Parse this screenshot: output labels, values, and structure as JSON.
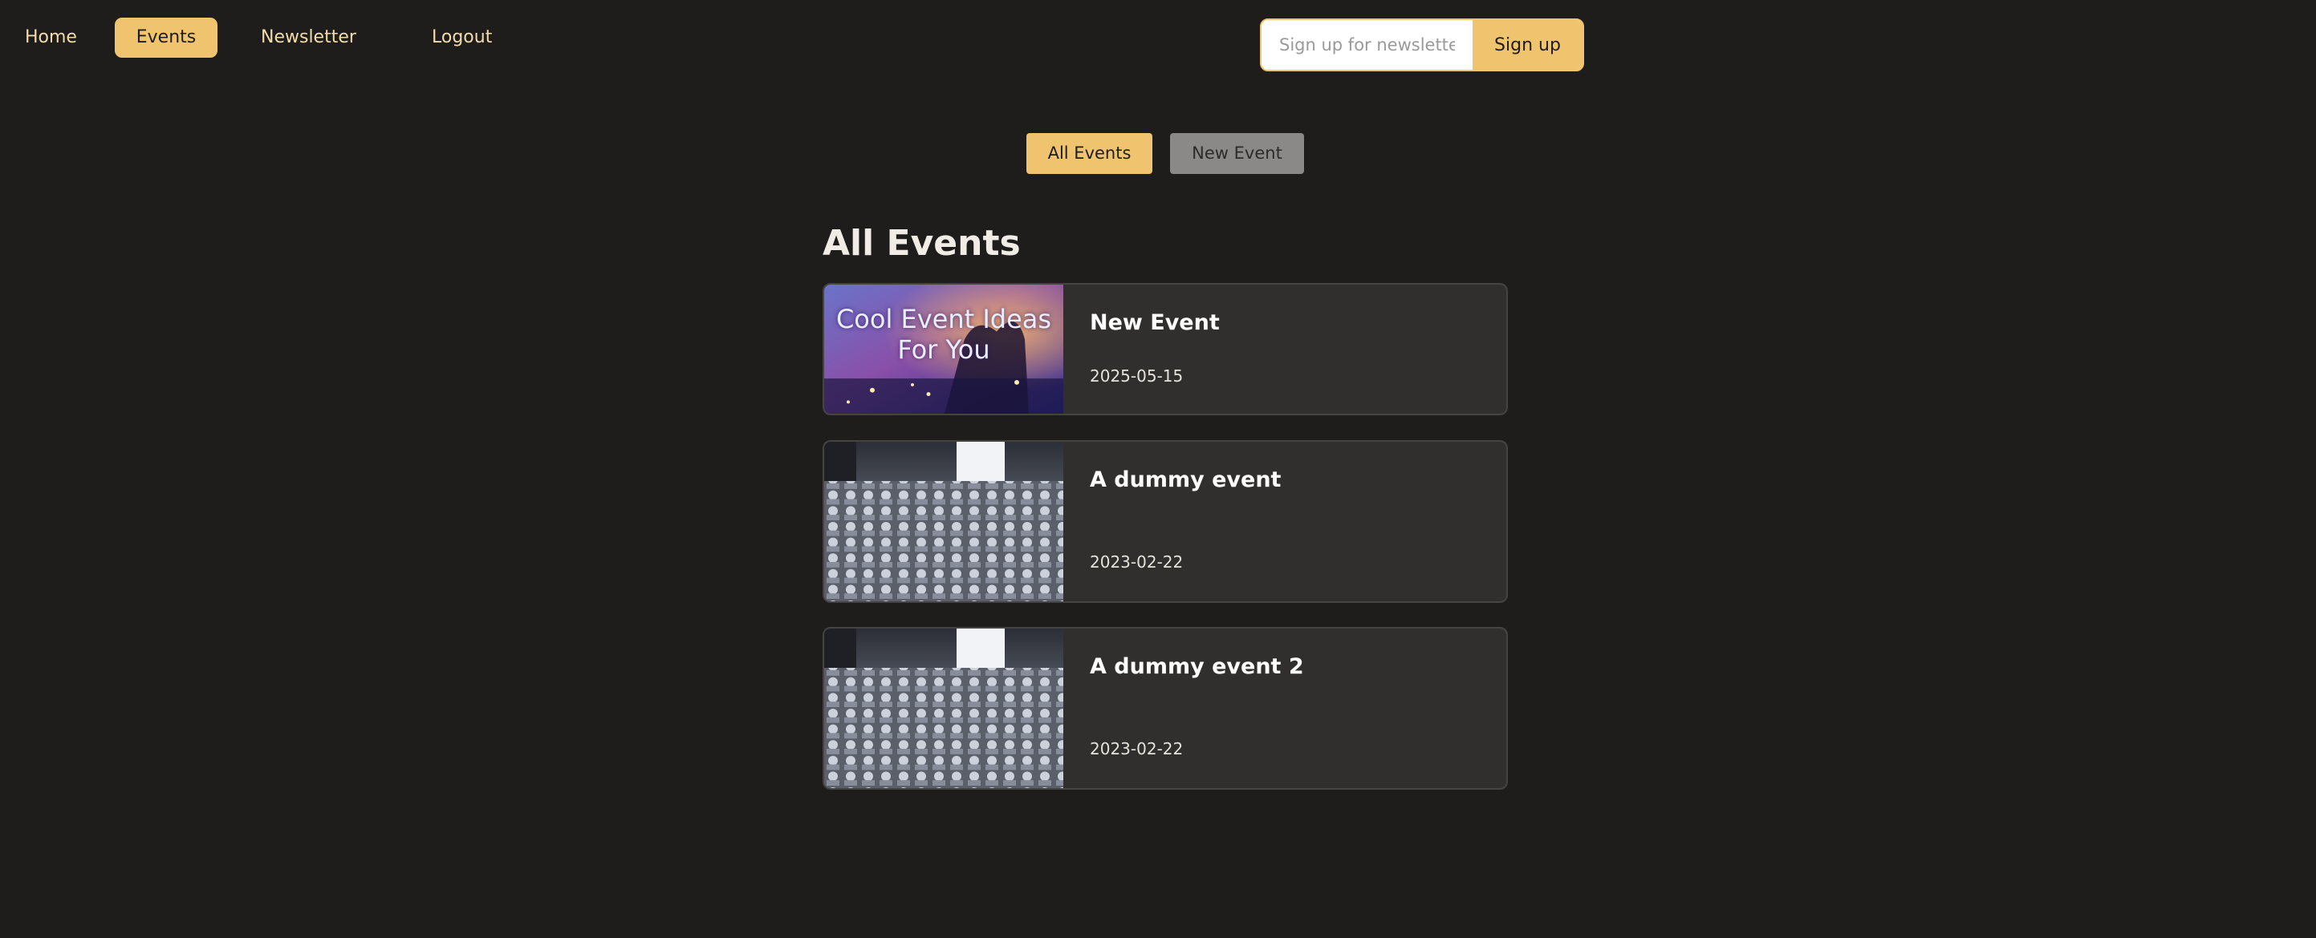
{
  "nav": {
    "home": "Home",
    "events": "Events",
    "newsletter": "Newsletter",
    "logout": "Logout"
  },
  "newsletter_form": {
    "placeholder": "Sign up for newsletter...",
    "button": "Sign up"
  },
  "subnav": {
    "all_events": "All Events",
    "new_event": "New Event"
  },
  "page_title": "All Events",
  "events": [
    {
      "title": "New Event",
      "date": "2025-05-15",
      "image_caption": "Cool Event Ideas For You"
    },
    {
      "title": "A dummy event",
      "date": "2023-02-22"
    },
    {
      "title": "A dummy event 2",
      "date": "2023-02-22"
    }
  ],
  "colors": {
    "background": "#1e1d1c",
    "accent": "#f0c46e",
    "nav_text": "#f4dcaa",
    "card_background": "#302f2e",
    "card_border": "#454443",
    "secondary_button": "#8a8988"
  }
}
